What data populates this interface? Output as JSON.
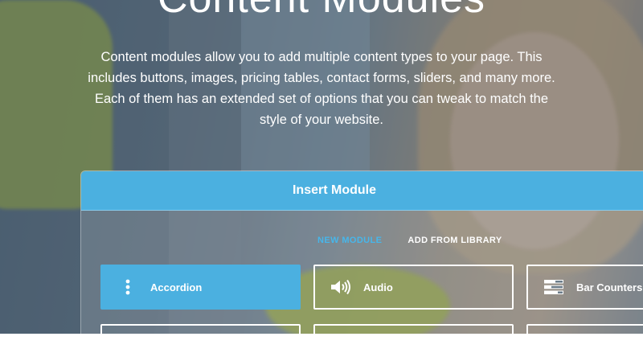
{
  "section": {
    "heading": "Content Modules",
    "intro": "Content modules allow you to add multiple content types to your page. This includes buttons, images, pricing tables, contact forms, sliders, and many more. Each of them has an extended set of options that you can tweak to match the style of your website."
  },
  "modal": {
    "title": "Insert Module",
    "tabs": [
      {
        "label": "NEW MODULE",
        "active": true
      },
      {
        "label": "ADD FROM LIBRARY",
        "active": false
      }
    ],
    "modules": [
      {
        "label": "Accordion",
        "icon": "accordion-icon",
        "selected": true
      },
      {
        "label": "Audio",
        "icon": "audio-icon",
        "selected": false
      },
      {
        "label": "Bar Counters",
        "icon": "bar-counters-icon",
        "selected": false
      }
    ]
  },
  "colors": {
    "accent": "#4bb0e0",
    "tab_active": "#47b6ea"
  }
}
